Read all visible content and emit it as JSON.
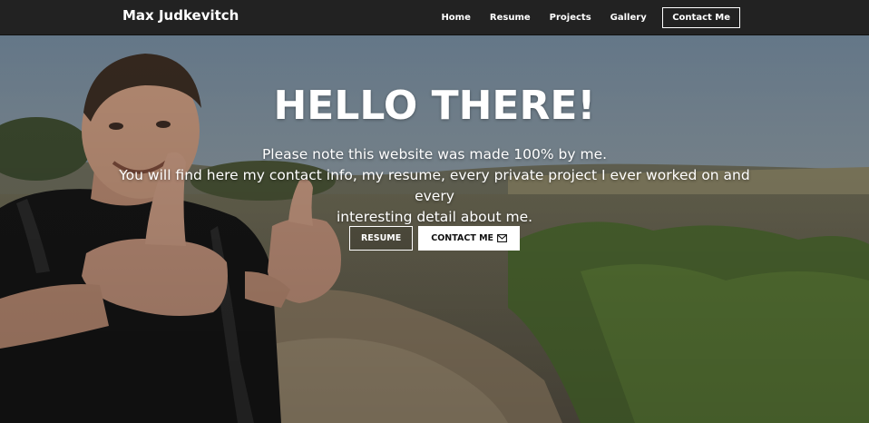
{
  "navbar": {
    "brand": "Max Judkevitch",
    "links": [
      {
        "label": "Home",
        "icon": null
      },
      {
        "label": "Resume",
        "icon": null
      },
      {
        "label": "Projects",
        "icon": null
      },
      {
        "label": "Gallery",
        "icon": null
      }
    ],
    "contact_label": "Contact Me"
  },
  "hero": {
    "title": "HELLO THERE!",
    "subtitle_lines": [
      "Please note this website was made 100% by me.",
      "You will find here my contact info, my resume, every private project I ever worked on and every",
      "interesting detail about me."
    ],
    "buttons": {
      "resume_label": "RESUME",
      "contact_label": "CONTACT ME",
      "contact_icon": "envelope-icon"
    },
    "background": "hero-photo"
  },
  "colors": {
    "navbar_bg": "#222222",
    "text": "#ffffff",
    "button_solid_bg": "#ffffff",
    "button_solid_text": "#111111"
  }
}
